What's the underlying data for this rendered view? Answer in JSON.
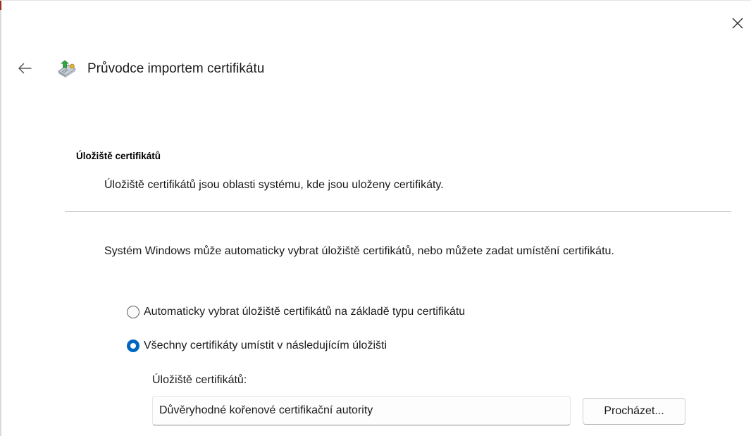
{
  "window": {
    "title": "Průvodce importem certifikátu",
    "close_icon": "close-icon",
    "back_icon": "back-arrow-icon",
    "wizard_icon": "certificate-import-icon"
  },
  "header": {
    "section_title": "Úložiště certifikátů",
    "section_description": "Úložiště certifikátů jsou oblasti systému, kde jsou uloženy certifikáty."
  },
  "body": {
    "intro": "Systém Windows může automaticky vybrat úložiště certifikátů, nebo můžete zadat umístění certifikátu.",
    "options": [
      {
        "label": "Automaticky vybrat úložiště certifikátů na základě typu certifikátu",
        "selected": false
      },
      {
        "label": "Všechny certifikáty umístit v následujícím úložišti",
        "selected": true
      }
    ],
    "store": {
      "label": "Úložiště certifikátů:",
      "value": "Důvěryhodné kořenové certifikační autority",
      "browse_label": "Procházet..."
    }
  },
  "colors": {
    "accent": "#0067c0",
    "text": "#1a1a1a",
    "divider": "#c4c4c4"
  }
}
